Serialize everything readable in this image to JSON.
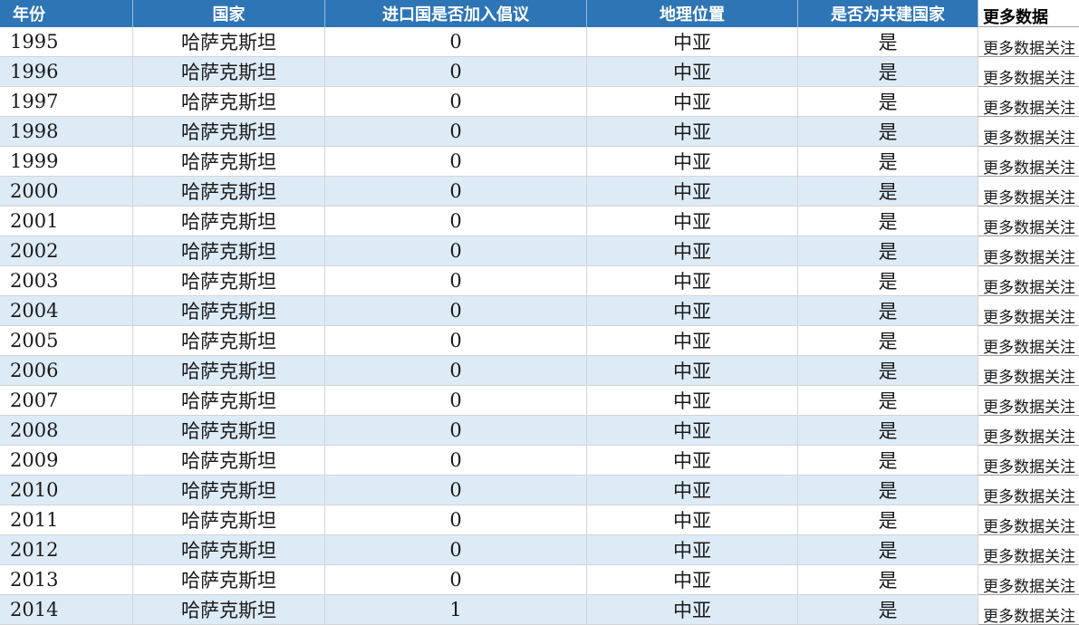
{
  "header": {
    "columns": [
      "年份",
      "国家",
      "进口国是否加入倡议",
      "地理位置",
      "是否为共建国家",
      "更多数据"
    ]
  },
  "more_text": "更多数据关注",
  "rows": [
    [
      "1995",
      "哈萨克斯坦",
      "0",
      "中亚",
      "是"
    ],
    [
      "1996",
      "哈萨克斯坦",
      "0",
      "中亚",
      "是"
    ],
    [
      "1997",
      "哈萨克斯坦",
      "0",
      "中亚",
      "是"
    ],
    [
      "1998",
      "哈萨克斯坦",
      "0",
      "中亚",
      "是"
    ],
    [
      "1999",
      "哈萨克斯坦",
      "0",
      "中亚",
      "是"
    ],
    [
      "2000",
      "哈萨克斯坦",
      "0",
      "中亚",
      "是"
    ],
    [
      "2001",
      "哈萨克斯坦",
      "0",
      "中亚",
      "是"
    ],
    [
      "2002",
      "哈萨克斯坦",
      "0",
      "中亚",
      "是"
    ],
    [
      "2003",
      "哈萨克斯坦",
      "0",
      "中亚",
      "是"
    ],
    [
      "2004",
      "哈萨克斯坦",
      "0",
      "中亚",
      "是"
    ],
    [
      "2005",
      "哈萨克斯坦",
      "0",
      "中亚",
      "是"
    ],
    [
      "2006",
      "哈萨克斯坦",
      "0",
      "中亚",
      "是"
    ],
    [
      "2007",
      "哈萨克斯坦",
      "0",
      "中亚",
      "是"
    ],
    [
      "2008",
      "哈萨克斯坦",
      "0",
      "中亚",
      "是"
    ],
    [
      "2009",
      "哈萨克斯坦",
      "0",
      "中亚",
      "是"
    ],
    [
      "2010",
      "哈萨克斯坦",
      "0",
      "中亚",
      "是"
    ],
    [
      "2011",
      "哈萨克斯坦",
      "0",
      "中亚",
      "是"
    ],
    [
      "2012",
      "哈萨克斯坦",
      "0",
      "中亚",
      "是"
    ],
    [
      "2013",
      "哈萨克斯坦",
      "0",
      "中亚",
      "是"
    ],
    [
      "2014",
      "哈萨克斯坦",
      "1",
      "中亚",
      "是"
    ]
  ],
  "colors": {
    "header_bg": "#2e75b6",
    "header_text": "#ffffff",
    "band_bg": "#ddebf7"
  }
}
